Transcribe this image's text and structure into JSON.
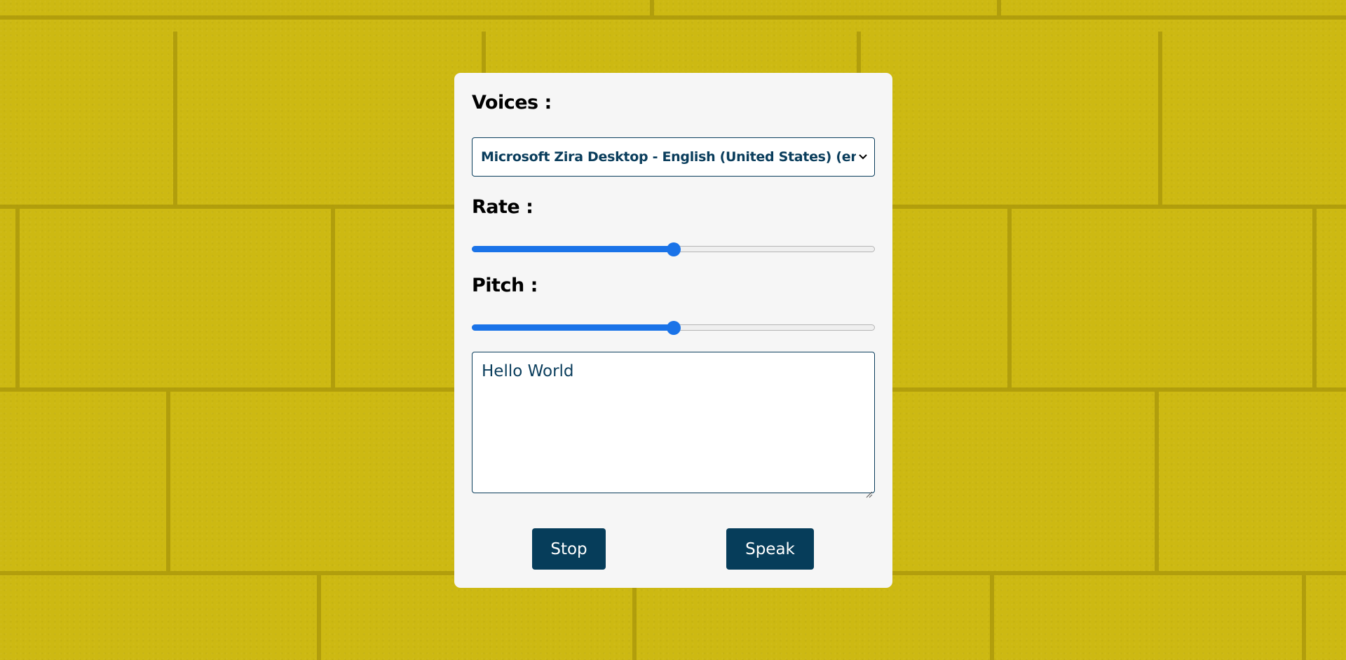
{
  "voices": {
    "label": "Voices :",
    "selected": "Microsoft Zira Desktop - English (United States) (en-US)"
  },
  "rate": {
    "label": "Rate :",
    "value_fraction": 0.5
  },
  "pitch": {
    "label": "Pitch :",
    "value_fraction": 0.5
  },
  "text_input": {
    "value": "Hello World"
  },
  "buttons": {
    "stop_label": "Stop",
    "speak_label": "Speak"
  },
  "colors": {
    "background": "#cdb912",
    "card": "#f6f6f6",
    "accent": "#0a3d5c",
    "slider": "#1a73e8"
  },
  "icons": {
    "select_chevron": "chevron-down-icon",
    "textarea_resize": "resize-handle-icon"
  }
}
